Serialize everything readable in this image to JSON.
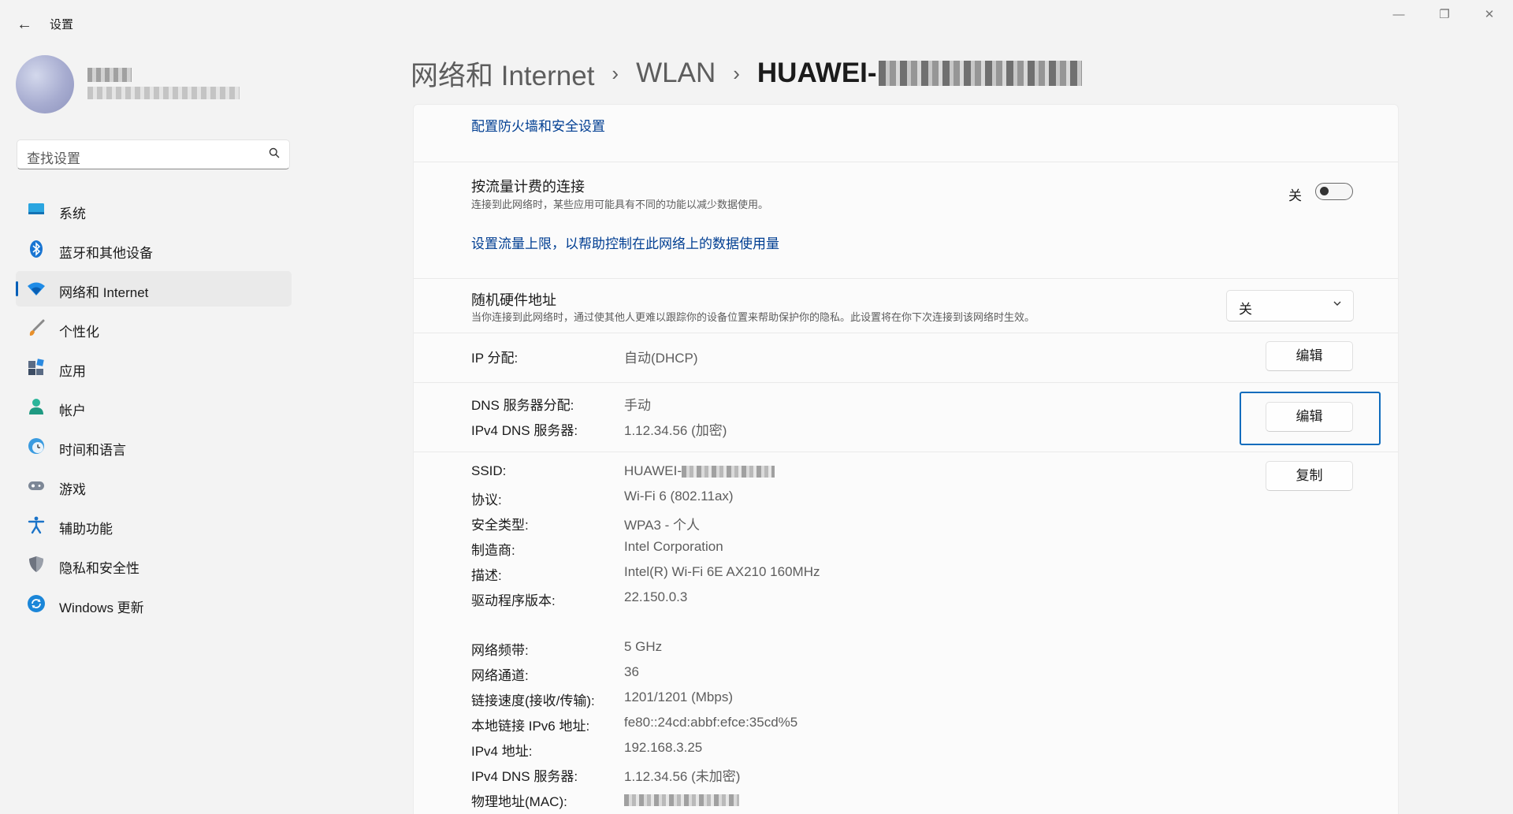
{
  "window": {
    "title": "设置",
    "back_glyph": "←",
    "min_glyph": "—",
    "max_glyph": "❐",
    "close_glyph": "✕"
  },
  "search": {
    "placeholder": "查找设置",
    "icon": "search-icon"
  },
  "nav": [
    {
      "label": "系统",
      "icon": "monitor-icon"
    },
    {
      "label": "蓝牙和其他设备",
      "icon": "bluetooth-icon"
    },
    {
      "label": "网络和 Internet",
      "icon": "wifi-icon",
      "active": true
    },
    {
      "label": "个性化",
      "icon": "brush-icon"
    },
    {
      "label": "应用",
      "icon": "apps-icon"
    },
    {
      "label": "帐户",
      "icon": "person-icon"
    },
    {
      "label": "时间和语言",
      "icon": "clock-globe-icon"
    },
    {
      "label": "游戏",
      "icon": "gamepad-icon"
    },
    {
      "label": "辅助功能",
      "icon": "accessibility-icon"
    },
    {
      "label": "隐私和安全性",
      "icon": "shield-icon"
    },
    {
      "label": "Windows 更新",
      "icon": "update-icon"
    }
  ],
  "breadcrumb": {
    "part1": "网络和 Internet",
    "sep": "›",
    "part2": "WLAN",
    "part3_prefix": "HUAWEI-"
  },
  "firewall_link": "配置防火墙和安全设置",
  "metered": {
    "title": "按流量计费的连接",
    "desc": "连接到此网络时，某些应用可能具有不同的功能以减少数据使用。",
    "toggle_label": "关",
    "toggle_on": false,
    "data_limit_link": "设置流量上限，以帮助控制在此网络上的数据使用量"
  },
  "random_mac": {
    "title": "随机硬件地址",
    "desc": "当你连接到此网络时，通过使其他人更难以跟踪你的设备位置来帮助保护你的隐私。此设置将在你下次连接到该网络时生效。",
    "selected": "关"
  },
  "ip_assignment": {
    "key": "IP 分配:",
    "value": "自动(DHCP)",
    "button": "编辑"
  },
  "dns": {
    "key1": "DNS 服务器分配:",
    "value1": "手动",
    "key2": "IPv4 DNS 服务器:",
    "value2": "1.12.34.56 (加密)",
    "button": "编辑"
  },
  "properties": {
    "copy_button": "复制",
    "ssid_key": "SSID:",
    "ssid_prefix": "HUAWEI-",
    "items_a": [
      {
        "k": "协议:",
        "v": "Wi-Fi 6 (802.11ax)"
      },
      {
        "k": "安全类型:",
        "v": "WPA3 - 个人"
      },
      {
        "k": "制造商:",
        "v": "Intel Corporation"
      },
      {
        "k": "描述:",
        "v": "Intel(R) Wi-Fi 6E AX210 160MHz"
      },
      {
        "k": "驱动程序版本:",
        "v": "22.150.0.3"
      }
    ],
    "items_b": [
      {
        "k": "网络频带:",
        "v": "5 GHz"
      },
      {
        "k": "网络通道:",
        "v": "36"
      },
      {
        "k": "链接速度(接收/传输):",
        "v": "1201/1201 (Mbps)"
      },
      {
        "k": "本地链接 IPv6 地址:",
        "v": "fe80::24cd:abbf:efce:35cd%5"
      },
      {
        "k": "IPv4 地址:",
        "v": "192.168.3.25"
      },
      {
        "k": "IPv4 DNS 服务器:",
        "v": "1.12.34.56 (未加密)"
      }
    ],
    "mac_key": "物理地址(MAC):"
  },
  "colors": {
    "accent": "#005fb8",
    "link": "#003e92",
    "focus": "#0f6cbd",
    "window_bg": "#f3f3f3",
    "card_bg": "#fbfbfb"
  }
}
